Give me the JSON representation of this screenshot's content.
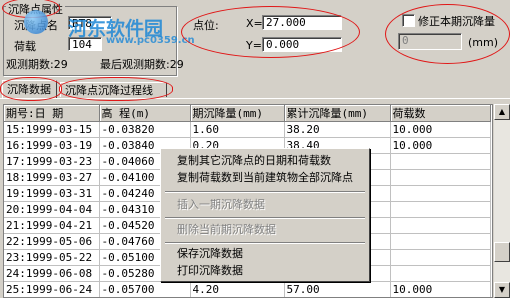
{
  "group": {
    "title": "沉降点属性",
    "point_name_label": "沉降点名",
    "point_name_value": "BT8",
    "load_label": "荷载",
    "load_value": "104",
    "obs_count_text": "观测期数:29",
    "last_obs_text": "最后观测期数:29"
  },
  "position": {
    "label": "点位:",
    "x_label": "X=",
    "x_value": "27.000",
    "y_label": "Y=",
    "y_value": "0.000"
  },
  "correction": {
    "checkbox_label": "修正本期沉降量",
    "checked": false,
    "value": "0",
    "unit": "(mm)"
  },
  "tabs": [
    {
      "label": "沉降数据",
      "active": true
    },
    {
      "label": "沉降点沉降过程线",
      "active": false
    }
  ],
  "table": {
    "columns": [
      "期号:日 期",
      "高  程(m)",
      "期沉降量(mm)",
      "累计沉降量(mm)",
      "荷载数"
    ],
    "rows": [
      [
        "15:1999-03-15",
        "-0.03820",
        "1.60",
        "38.20",
        "10.000"
      ],
      [
        "16:1999-03-19",
        "-0.03840",
        "0.20",
        "38.40",
        "10.000"
      ],
      [
        "17:1999-03-23",
        "-0.04060",
        "",
        "",
        ""
      ],
      [
        "18:1999-03-27",
        "-0.04100",
        "",
        "",
        ""
      ],
      [
        "19:1999-03-31",
        "-0.04240",
        "",
        "",
        ""
      ],
      [
        "20:1999-04-04",
        "-0.04310",
        "",
        "",
        ""
      ],
      [
        "21:1999-04-21",
        "-0.04520",
        "",
        "",
        ""
      ],
      [
        "22:1999-05-06",
        "-0.04760",
        "",
        "",
        ""
      ],
      [
        "23:1999-05-22",
        "-0.05100",
        "",
        "",
        ""
      ],
      [
        "24:1999-06-08",
        "-0.05280",
        "",
        "",
        ""
      ],
      [
        "25:1999-06-24",
        "-0.05700",
        "4.20",
        "57.00",
        "10.000"
      ]
    ]
  },
  "context_menu": {
    "items": [
      {
        "label": "复制其它沉降点的日期和荷载数",
        "enabled": true
      },
      {
        "label": "复制荷载数到当前建筑物全部沉降点",
        "enabled": true
      },
      {
        "label": "插入一期沉降数据",
        "enabled": false
      },
      {
        "label": "删除当前期沉降数据",
        "enabled": false
      },
      {
        "label": "保存沉降数据",
        "enabled": true
      },
      {
        "label": "打印沉降数据",
        "enabled": true
      }
    ]
  },
  "watermark": {
    "title": "河东软件园",
    "url": "www.pc0359.cn"
  },
  "colors": {
    "window": "#d4d0c8",
    "annotation_red": "#e01818",
    "watermark_blue": "#1e88d6"
  }
}
